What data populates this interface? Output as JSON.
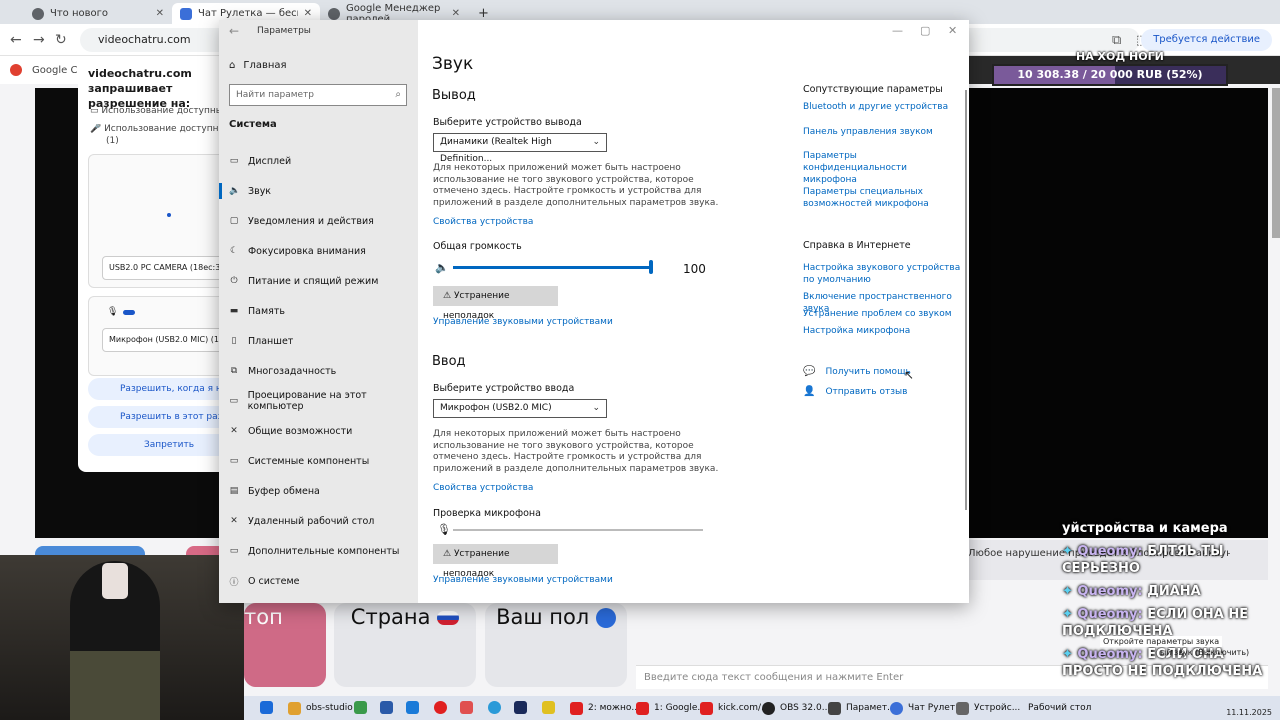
{
  "browser": {
    "tabs": [
      {
        "label": "Что нового",
        "color": "#5f6368"
      },
      {
        "label": "Чат Рулетка — бесплатный ви",
        "color": "#3b6fd8"
      },
      {
        "label": "Google Менеджер паролей",
        "color": "#5f6368"
      }
    ],
    "new_tab": "+",
    "url": "videochatru.com",
    "update_button": "Требуется действие",
    "bookmark": "Google Chro"
  },
  "permission_popup": {
    "title": "videochatru.com запрашивает разрешение на:",
    "rows": [
      "Использование доступных ка",
      "Использование доступных ми",
      "(1)"
    ],
    "camera_select": "USB2.0 PC CAMERA (18ec:3399)",
    "mic_select": "Микрофон (USB2.0 MIC) (18ec:3",
    "buttons": [
      "Разрешить, когда я на са",
      "Разрешить в этот раз",
      "Запретить"
    ]
  },
  "stream_overlay": {
    "top_text": "НА ХОД НОГИ",
    "progress_text": "10 308.38 / 20 000 RUB (52%)",
    "progress": 0.52
  },
  "chat_page": {
    "card_pink": "топ",
    "card_country": "Страна",
    "card_gender": "Ваш пол",
    "chat_input_placeholder": "Введите сюда текст сообщения и нажмите Enter",
    "warning": "Любое нарушение приведет к блокировке аккаунта.",
    "tooltip1": "Откройте параметры звука",
    "tooltip2": "ый звук (Выключить)"
  },
  "chat_messages": [
    {
      "user": "",
      "text": "уйстройства и камера"
    },
    {
      "user": "Queomy:",
      "text": "БЛТЯЬ ТЫ СЕРЬЕЗНО"
    },
    {
      "user": "Queomy:",
      "text": "ДИАНА"
    },
    {
      "user": "Queomy:",
      "text": "ЕСЛИ ОНА НЕ ПОДКЛЮЧЕНА"
    },
    {
      "user": "Queomy:",
      "text": "ЕСЛИ ОНА ПРОСТО НЕ ПОДКЛЮЧЕНА"
    }
  ],
  "taskbar": {
    "items": [
      {
        "label": "obs-studio",
        "color": "#e0a030"
      },
      {
        "label": "2: можно...",
        "color": "#e02020"
      },
      {
        "label": "1: Google...",
        "color": "#e02020"
      },
      {
        "label": "kick.com/...",
        "color": "#e02020"
      },
      {
        "label": "OBS 32.0...",
        "color": "#222222"
      },
      {
        "label": "Парамет...",
        "color": "#444444"
      },
      {
        "label": "Чат Рулет...",
        "color": "#3b6fd8"
      },
      {
        "label": "Устройс...",
        "color": "#666666"
      }
    ],
    "desktop_label": "Рабочий стол",
    "date": "11.11.2025"
  },
  "settings": {
    "window_title": "Параметры",
    "home": "Главная",
    "search_placeholder": "Найти параметр",
    "section": "Система",
    "nav": [
      {
        "label": "Дисплей",
        "icon": "monitor-icon",
        "glyph": "▭"
      },
      {
        "label": "Звук",
        "icon": "speaker-icon",
        "glyph": "🔈"
      },
      {
        "label": "Уведомления и действия",
        "icon": "notification-icon",
        "glyph": "▢"
      },
      {
        "label": "Фокусировка внимания",
        "icon": "moon-icon",
        "glyph": "☾"
      },
      {
        "label": "Питание и спящий режим",
        "icon": "power-icon",
        "glyph": "⏻"
      },
      {
        "label": "Память",
        "icon": "storage-icon",
        "glyph": "▬"
      },
      {
        "label": "Планшет",
        "icon": "tablet-icon",
        "glyph": "▯"
      },
      {
        "label": "Многозадачность",
        "icon": "multitask-icon",
        "glyph": "⧉"
      },
      {
        "label": "Проецирование на этот компьютер",
        "icon": "projection-icon",
        "glyph": "▭"
      },
      {
        "label": "Общие возможности",
        "icon": "share-icon",
        "glyph": "✕"
      },
      {
        "label": "Системные компоненты",
        "icon": "components-icon",
        "glyph": "▭"
      },
      {
        "label": "Буфер обмена",
        "icon": "clipboard-icon",
        "glyph": "▤"
      },
      {
        "label": "Удаленный рабочий стол",
        "icon": "remote-icon",
        "glyph": "✕"
      },
      {
        "label": "Дополнительные компоненты",
        "icon": "extras-icon",
        "glyph": "▭"
      },
      {
        "label": "О системе",
        "icon": "info-icon",
        "glyph": "ⓘ"
      }
    ],
    "active_index": 1,
    "page_title": "Звук",
    "output": {
      "heading": "Вывод",
      "select_label": "Выберите устройство вывода",
      "device": "Динамики (Realtek High Definition...",
      "description": "Для некоторых приложений может быть настроено использование не того звукового устройства, которое отмечено здесь. Настройте громкость и устройства для приложений в разделе дополнительных параметров звука.",
      "properties_link": "Свойства устройства",
      "volume_label": "Общая громкость",
      "volume": 100,
      "troubleshoot": "Устранение неполадок",
      "manage_link": "Управление звуковыми устройствами"
    },
    "input": {
      "heading": "Ввод",
      "select_label": "Выберите устройство ввода",
      "device": "Микрофон (USB2.0 MIC)",
      "description": "Для некоторых приложений может быть настроено использование не того звукового устройства, которое отмечено здесь. Настройте громкость и устройства для приложений в разделе дополнительных параметров звука.",
      "properties_link": "Свойства устройства",
      "mic_test_label": "Проверка микрофона",
      "mic_level": 0,
      "troubleshoot": "Устранение неполадок",
      "manage_link": "Управление звуковыми устройствами"
    },
    "related": {
      "heading": "Сопутствующие параметры",
      "links": [
        "Bluetooth и другие устройства",
        "Панель управления звуком",
        "Параметры конфиденциальности микрофона",
        "Параметры специальных возможностей микрофона"
      ]
    },
    "web_help": {
      "heading": "Справка в Интернете",
      "links": [
        "Настройка звукового устройства по умолчанию",
        "Включение пространственного звука",
        "Устранение проблем со звуком",
        "Настройка микрофона"
      ]
    },
    "get_help": "Получить помощь",
    "feedback": "Отправить отзыв"
  }
}
